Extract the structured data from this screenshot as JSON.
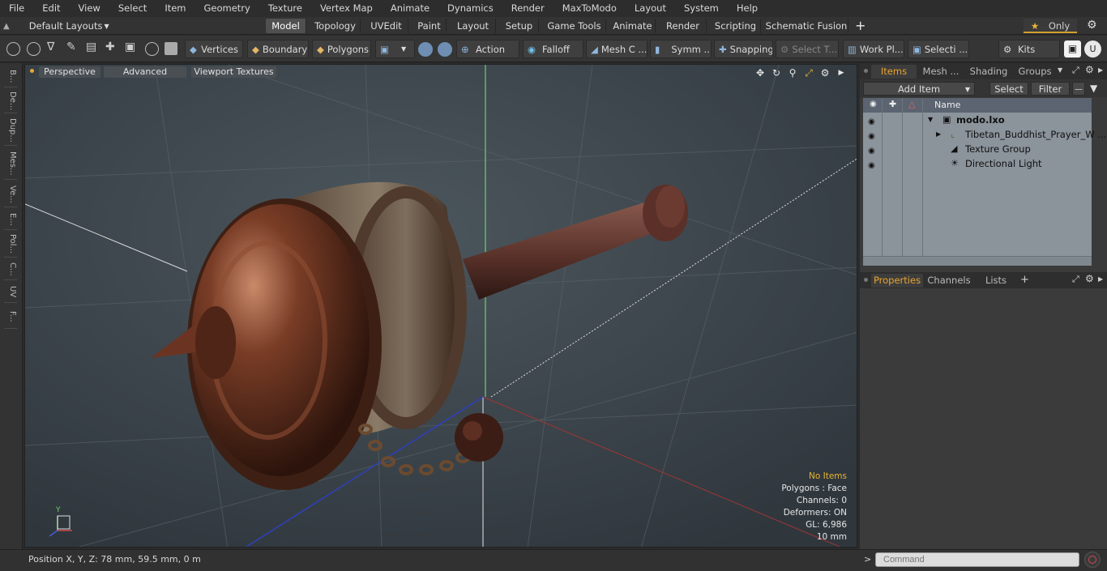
{
  "menu": [
    "File",
    "Edit",
    "View",
    "Select",
    "Item",
    "Geometry",
    "Texture",
    "Vertex Map",
    "Animate",
    "Dynamics",
    "Render",
    "MaxToModo",
    "Layout",
    "System",
    "Help"
  ],
  "layout_switch": "Default Layouts",
  "mode_tabs": [
    "Model",
    "Topology",
    "UVEdit",
    "Paint",
    "Layout",
    "Setup",
    "Game Tools",
    "Animate",
    "Render",
    "Scripting",
    "Schematic Fusion"
  ],
  "only_label": "Only",
  "toolbar": {
    "vertices": "Vertices",
    "boundary": "Boundary",
    "polygons": "Polygons",
    "action": "Action",
    "falloff": "Falloff",
    "mesh": "Mesh C ...",
    "symm": "Symm ...",
    "snapping": "Snapping",
    "selectt": "Select T...",
    "workpl": "Work Pl...",
    "selecti": "Selecti ...",
    "kits": "Kits"
  },
  "left_tabs": [
    "B...",
    "De...",
    "Dup...",
    "Mes...",
    "Ve...",
    "E...",
    "Pol...",
    "C...",
    "UV",
    "F..."
  ],
  "viewport": {
    "tab_perspective": "Perspective",
    "tab_advanced": "Advanced",
    "tab_textures": "Viewport Textures",
    "hud": {
      "no_items": "No Items",
      "polygons": "Polygons : Face",
      "channels": "Channels: 0",
      "deformers": "Deformers: ON",
      "gl": "GL: 6,986",
      "scale": "10 mm"
    },
    "axis_labels": {
      "y": "Y"
    }
  },
  "right_panel": {
    "tabs": [
      "Items",
      "Mesh ...",
      "Shading",
      "Groups"
    ],
    "add_item": "Add Item",
    "select": "Select",
    "filter": "Filter",
    "name_col": "Name",
    "tree": [
      {
        "label": "modo.lxo"
      },
      {
        "label": "Tibetan_Buddhist_Prayer_W ..."
      },
      {
        "label": "Texture Group"
      },
      {
        "label": "Directional Light"
      }
    ],
    "props_tabs": [
      "Properties",
      "Channels",
      "Lists"
    ]
  },
  "status": {
    "position": "Position X, Y, Z:   78 mm, 59.5 mm, 0 m",
    "command_placeholder": "Command"
  },
  "colors": {
    "accent": "#e9a531",
    "viewport_bg": "#3d464d",
    "tree_bg": "#8b939b"
  }
}
